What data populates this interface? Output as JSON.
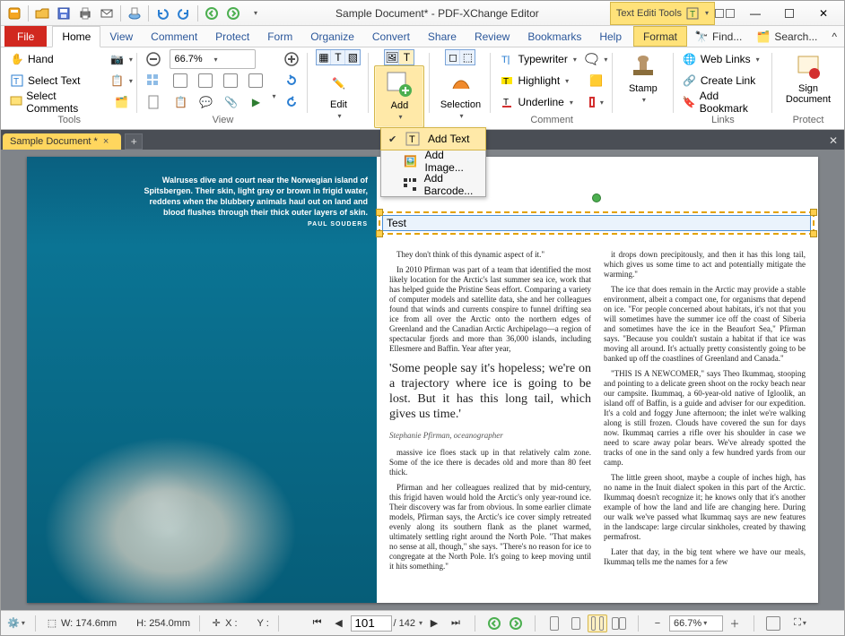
{
  "app_title": "Sample Document* - PDF-XChange Editor",
  "tool_context_label": "Text Editi Tools",
  "ribbon_tabs": {
    "file": "File",
    "home": "Home",
    "view": "View",
    "comment": "Comment",
    "protect": "Protect",
    "form": "Form",
    "organize": "Organize",
    "convert": "Convert",
    "share": "Share",
    "review": "Review",
    "bookmarks": "Bookmarks",
    "help": "Help",
    "format": "Format"
  },
  "ribbon_right": {
    "find": "Find...",
    "search": "Search..."
  },
  "groups": {
    "tools": {
      "label": "Tools",
      "hand": "Hand",
      "select_text": "Select Text",
      "select_comments": "Select Comments"
    },
    "view": {
      "label": "View",
      "zoom_value": "66.7%"
    },
    "edit": "Edit",
    "add": "Add",
    "selection": "Selection",
    "comment": {
      "label": "Comment",
      "typewriter": "Typewriter",
      "highlight": "Highlight",
      "underline": "Underline"
    },
    "stamp": "Stamp",
    "links": {
      "label": "Links",
      "web_links": "Web Links",
      "create_link": "Create Link",
      "add_bookmark": "Add Bookmark"
    },
    "protect": {
      "label": "Protect",
      "sign": "Sign Document"
    }
  },
  "add_menu": {
    "add_text": "Add Text",
    "add_image": "Add Image...",
    "add_barcode": "Add Barcode..."
  },
  "doc_tab": "Sample Document *",
  "page_caption": "Walruses dive and court near the Norwegian island of Spitsbergen. Their skin, light gray or brown in frigid water, reddens when the blubbery animals haul out on land and blood flushes through their thick outer layers of skin.",
  "caption_credit": "PAUL SOUDERS",
  "text_field_value": "Test",
  "article": {
    "p1": "They don't think of this dynamic aspect of it.\"",
    "p2": "In 2010 Pfirman was part of a team that identified the most likely location for the Arctic's last summer sea ice, work that has helped guide the Pristine Seas effort. Comparing a variety of computer models and satellite data, she and her colleagues found that winds and currents conspire to funnel drifting sea ice from all over the Arctic onto the northern edges of Greenland and the Canadian Arctic Archipelago—a region of spectacular fjords and more than 36,000 islands, including Ellesmere and Baffin. Year after year,",
    "pull_quote": "'Some people say it's hopeless; we're on a trajectory where ice is going to be lost. But it has this long tail, which gives us time.'",
    "pq_credit": "Stephanie Pfirman, oceanographer",
    "p3": "massive ice floes stack up in that relatively calm zone. Some of the ice there is decades old and more than 80 feet thick.",
    "p4": "Pfirman and her colleagues realized that by mid-century, this frigid haven would hold the Arctic's only year-round ice. Their discovery was far from obvious. In some earlier climate models, Pfirman says, the Arctic's ice cover simply retreated evenly along its southern flank as the planet warmed, ultimately settling right around the North Pole. \"That makes no sense at all, though,\" she says. \"There's no reason for ice to congregate at the North Pole. It's going to keep moving until it hits something.\"",
    "p5": "it drops down precipitously, and then it has this long tail, which gives us some time to act and potentially mitigate the warming.\"",
    "p6": "The ice that does remain in the Arctic may provide a stable environment, albeit a compact one, for organisms that depend on ice. \"For people concerned about habitats, it's not that you will sometimes have the summer ice off the coast of Siberia and sometimes have the ice in the Beaufort Sea,\" Pfirman says. \"Because you couldn't sustain a habitat if that ice was moving all around. It's actually pretty consistently going to be banked up off the coastlines of Greenland and Canada.\"",
    "p7": "\"THIS IS A NEWCOMER,\" says Theo Ikummaq, stooping and pointing to a delicate green shoot on the rocky beach near our campsite. Ikummaq, a 60-year-old native of Igloolik, an island off of Baffin, is a guide and adviser for our expedition. It's a cold and foggy June afternoon; the inlet we're walking along is still frozen. Clouds have covered the sun for days now. Ikummaq carries a rifle over his shoulder in case we need to scare away polar bears. We've already spotted the tracks of one in the sand only a few hundred yards from our camp.",
    "p8": "The little green shoot, maybe a couple of inches high, has no name in the Inuit dialect spoken in this part of the Arctic. Ikummaq doesn't recognize it; he knows only that it's another example of how the land and life are changing here. During our walk we've passed what Ikummaq says are new features in the landscape: large circular sinkholes, created by thawing permafrost.",
    "p9": "Later that day, in the big tent where we have our meals, Ikummaq tells me the names for a few"
  },
  "statusbar": {
    "w_label": "W:",
    "w_value": "174.6mm",
    "h_label": "H:",
    "h_value": "254.0mm",
    "x_label": "X :",
    "y_label": "Y :",
    "page_current": "101",
    "page_total": "/ 142",
    "zoom": "66.7%"
  }
}
